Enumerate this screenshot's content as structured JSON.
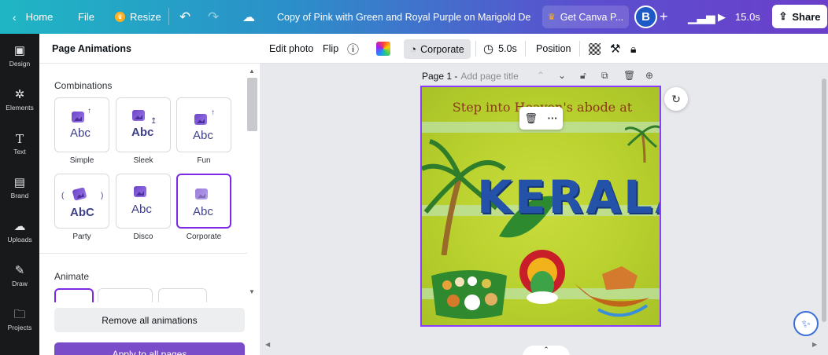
{
  "topbar": {
    "home": "Home",
    "file": "File",
    "resize": "Resize",
    "doc_title": "Copy of Pink with Green and Royal Purple on Marigold Deli...",
    "get_canva_pro": "Get Canva P...",
    "avatar_initial": "B",
    "duration": "15.0s",
    "share": "Share"
  },
  "rail": {
    "items": [
      {
        "label": "Design",
        "icon": "design-icon"
      },
      {
        "label": "Elements",
        "icon": "elements-icon"
      },
      {
        "label": "Text",
        "icon": "text-icon"
      },
      {
        "label": "Brand",
        "icon": "brand-icon"
      },
      {
        "label": "Uploads",
        "icon": "uploads-icon"
      },
      {
        "label": "Draw",
        "icon": "draw-icon"
      },
      {
        "label": "Projects",
        "icon": "projects-icon"
      }
    ]
  },
  "panel": {
    "title": "Page Animations",
    "combinations_title": "Combinations",
    "combinations": [
      {
        "label": "Simple",
        "glyph": "Abc"
      },
      {
        "label": "Sleek",
        "glyph": "Abc"
      },
      {
        "label": "Fun",
        "glyph": "Abc"
      },
      {
        "label": "Party",
        "glyph": "AbC"
      },
      {
        "label": "Disco",
        "glyph": "Abc"
      },
      {
        "label": "Corporate",
        "glyph": "Abc"
      }
    ],
    "selected": "Corporate",
    "animate_title": "Animate",
    "remove_all": "Remove all animations",
    "apply_all": "Apply to all pages"
  },
  "context_toolbar": {
    "edit_photo": "Edit photo",
    "flip": "Flip",
    "animation": "Corporate",
    "duration": "5.0s",
    "position": "Position"
  },
  "canvas": {
    "page_label": "Page 1 -",
    "page_title_placeholder": "Add page title",
    "design_heading": "Step into Heaven's abode at",
    "design_title": "KERALA"
  },
  "colors": {
    "accent": "#8b3dff",
    "design_bg": "#b7cf2c",
    "title_blue": "#2352a8",
    "heading_brown": "#8a3b1a"
  }
}
